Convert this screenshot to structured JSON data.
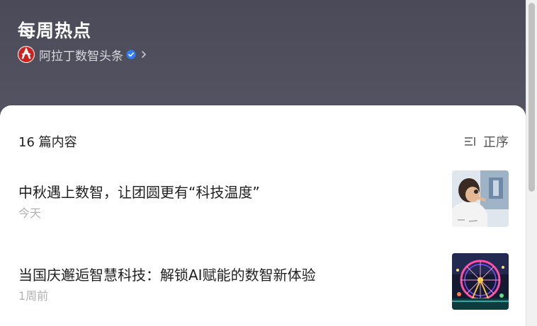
{
  "header": {
    "title": "每周热点",
    "author": "阿拉丁数智头条"
  },
  "list": {
    "count_label": "16 篇内容",
    "sort_label": "正序"
  },
  "articles": [
    {
      "title": "中秋遇上数智，让团圆更有“科技温度”",
      "time": "今天"
    },
    {
      "title": "当国庆邂逅智慧科技：解锁AI赋能的数智新体验",
      "time": "1周前"
    }
  ],
  "colors": {
    "header_bg": "#4a4a58",
    "brand_red": "#d0221c",
    "verified_blue": "#2f7cf6"
  }
}
